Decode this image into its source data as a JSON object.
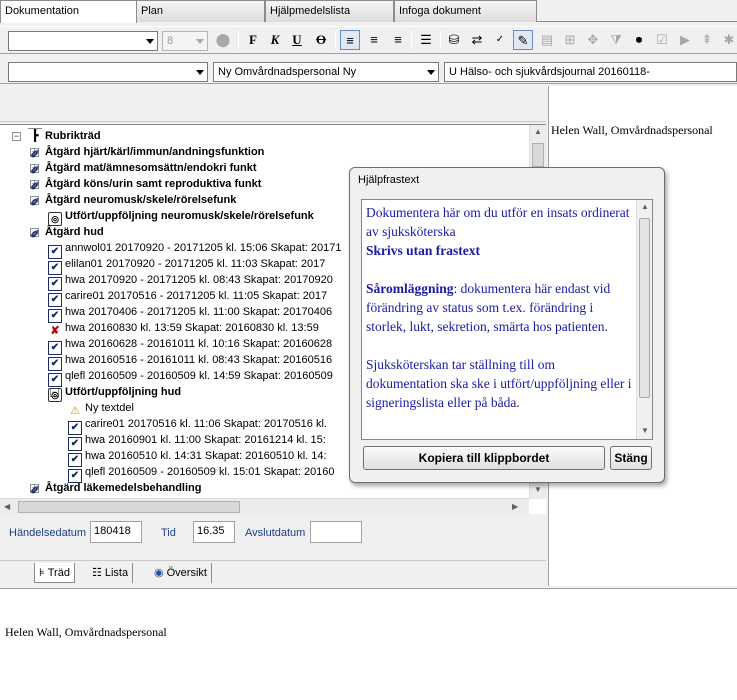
{
  "tabs": [
    "Dokumentation",
    "Plan",
    "Hjälpmedelslista",
    "Infoga dokument"
  ],
  "toolbar": {
    "font_combo": "",
    "size_combo": "8",
    "bold": "F",
    "italic": "K",
    "underline": "U",
    "strike": "O"
  },
  "row2": {
    "combo1": "",
    "combo2": "Ny Omvårdnadspersonal Ny",
    "combo3": "U Hälso- och sjukvårdsjournal 20160118-"
  },
  "tree": {
    "root": "Rubrikträd",
    "nodes": [
      {
        "label": "Åtgärd hjärt/kärl/immun/andningsfunktion",
        "bold": true
      },
      {
        "label": "Åtgärd mat/ämnesomsättn/endokri funkt",
        "bold": true
      },
      {
        "label": "Åtgärd köns/urin samt reproduktiva funkt",
        "bold": true
      },
      {
        "label": "Åtgärd  neuromusk/skele/rörelsefunk",
        "bold": true
      },
      {
        "label": "Utfört/uppföljning neuromusk/skele/rörelsefunk",
        "bold": true
      },
      {
        "label": "Åtgärd hud",
        "bold": true
      },
      {
        "label": "annwol01 20170920 - 20171205  kl. 15:06  Skapat: 20171",
        "bold": false
      },
      {
        "label": "elilan01 20170920 - 20171205  kl. 11:03  Skapat: 2017",
        "bold": false
      },
      {
        "label": "hwa 20170920 - 20171205  kl. 08:43  Skapat: 20170920",
        "bold": false
      },
      {
        "label": "carire01 20170516 - 20171205  kl. 11:05  Skapat: 2017",
        "bold": false
      },
      {
        "label": "hwa 20170406 - 20171205  kl. 11:00  Skapat: 20170406",
        "bold": false
      },
      {
        "label": "hwa 20160830  kl. 13:59  Skapat: 20160830 kl. 13:59",
        "bold": false
      },
      {
        "label": "hwa 20160628 - 20161011  kl. 10:16  Skapat: 20160628",
        "bold": false
      },
      {
        "label": "hwa 20160516 - 20161011  kl. 08:43  Skapat: 20160516",
        "bold": false
      },
      {
        "label": "qlefl 20160509 - 20160509  kl. 14:59  Skapat: 20160509",
        "bold": false
      },
      {
        "label": "Utfört/uppföljning hud",
        "bold": true
      },
      {
        "label": "Ny textdel",
        "bold": false
      },
      {
        "label": "carire01 20170516  kl. 11:06  Skapat: 20170516 kl.",
        "bold": false
      },
      {
        "label": "hwa 20160901  kl. 11:00  Skapat: 20161214 kl. 15:",
        "bold": false
      },
      {
        "label": "hwa 20160510  kl. 14:31  Skapat: 20160510 kl. 14:",
        "bold": false
      },
      {
        "label": "qlefl 20160509 - 20160509  kl. 15:01  Skapat: 20160",
        "bold": false
      },
      {
        "label": "Åtgärd läkemedelsbehandling",
        "bold": true
      }
    ]
  },
  "fields": {
    "event_date_label": "Händelsedatum",
    "event_date_value": "180418",
    "time_label": "Tid",
    "time_value": "16.35",
    "end_date_label": "Avslutdatum",
    "end_date_value": ""
  },
  "bottom_tabs": [
    "Träd",
    "Lista",
    "Översikt"
  ],
  "right_pane_text": "Helen Wall, Omvårdnadspersonal",
  "bottom_pane_text": "Helen Wall, Omvårdnadspersonal",
  "dialog": {
    "title": "Hjälpfrastext",
    "p1": "Dokumentera här om du utför en insats ordinerat av sjuksköterska",
    "p1_bold": "Skrivs utan frastext",
    "p2_bold": "Såromläggning",
    "p2": ": dokumentera här endast vid förändring av status som t.ex. förändring i storlek, lukt, sekretion, smärta hos patienten.",
    "p3": "Sjuksköterskan tar ställning till om dokumentation ska ske i utfört/uppföljning eller i signeringslista eller på båda.",
    "copy_button": "Kopiera till klippbordet",
    "close_button": "Stäng"
  }
}
